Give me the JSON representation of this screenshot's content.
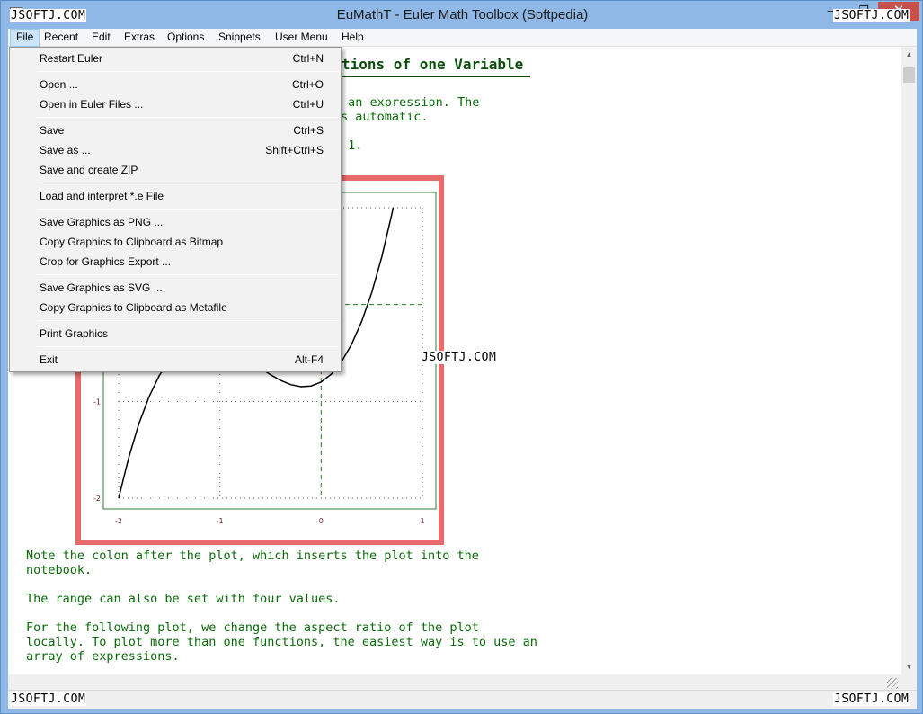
{
  "window": {
    "title": "EuMathT - Euler Math Toolbox (Softpedia)",
    "minimize_glyph": "—",
    "maximize_glyph": "❐",
    "close_glyph": "✕"
  },
  "watermarks": [
    "JSOFTJ.COM",
    "JSOFTJ.COM",
    "JSOFTJ.COM",
    "JSOFTJ.COM",
    "JSOFTJ.COM"
  ],
  "menubar": {
    "items": [
      "File",
      "Recent",
      "Edit",
      "Extras",
      "Options",
      "Snippets",
      "User Menu",
      "Help"
    ]
  },
  "file_menu": {
    "items": [
      {
        "label": "Restart Euler",
        "shortcut": "Ctrl+N"
      },
      {
        "label": "Open ...",
        "shortcut": "Ctrl+O"
      },
      {
        "label": "Open in Euler Files ...",
        "shortcut": "Ctrl+U"
      },
      {
        "label": "Save",
        "shortcut": "Ctrl+S"
      },
      {
        "label": "Save as ...",
        "shortcut": "Shift+Ctrl+S"
      },
      {
        "label": "Save and create ZIP",
        "shortcut": ""
      },
      {
        "label": "Load and interpret *.e File",
        "shortcut": ""
      },
      {
        "label": "Save Graphics as PNG ...",
        "shortcut": ""
      },
      {
        "label": "Copy Graphics to Clipboard as Bitmap",
        "shortcut": ""
      },
      {
        "label": "Crop for Graphics Export ...",
        "shortcut": ""
      },
      {
        "label": "Save Graphics as SVG ...",
        "shortcut": ""
      },
      {
        "label": "Copy Graphics to Clipboard as Metafile",
        "shortcut": ""
      },
      {
        "label": "Print Graphics",
        "shortcut": ""
      },
      {
        "label": "Exit",
        "shortcut": "Alt-F4"
      }
    ]
  },
  "notebook": {
    "heading": "tions of one Variable",
    "intro_line1": " an expression. The",
    "intro_line2": "s automatic.",
    "intro_line3": " 1.",
    "note1_line1": "Note the colon after the plot, which inserts the plot into the",
    "note1_line2": "notebook.",
    "note2": "The range can also be set with four values.",
    "note3_line1": "For the following plot, we change the aspect ratio of the plot",
    "note3_line2": "locally. To plot more than one functions, the easiest way is to use an",
    "note3_line3": "array of expressions."
  },
  "chart_data": {
    "type": "line",
    "xlim": [
      -2,
      1
    ],
    "ylim": [
      -2,
      1
    ],
    "x_tick_labels": [
      "-2",
      "-1",
      "0",
      "1"
    ],
    "y_tick_labels": [
      "-1",
      "-2"
    ],
    "grid": true,
    "series": [
      {
        "x": [
          -2.0,
          -1.9,
          -1.8,
          -1.7,
          -1.6,
          -1.5,
          -1.4,
          -1.3,
          -1.2,
          -1.1,
          -1.0,
          -0.9,
          -0.8,
          -0.7,
          -0.6,
          -0.5,
          -0.4,
          -0.3,
          -0.2,
          -0.1,
          0.0,
          0.1,
          0.2,
          0.3,
          0.4,
          0.5,
          0.6,
          0.7,
          0.8,
          0.9,
          1.0
        ],
        "y": [
          -2.0,
          -1.579,
          -1.232,
          -0.953,
          -0.736,
          -0.575,
          -0.464,
          -0.397,
          -0.368,
          -0.371,
          -0.4,
          -0.449,
          -0.512,
          -0.583,
          -0.656,
          -0.725,
          -0.784,
          -0.827,
          -0.848,
          -0.841,
          -0.8,
          -0.719,
          -0.592,
          -0.413,
          -0.176,
          0.125,
          0.496,
          0.943,
          1.472,
          2.089,
          2.8
        ]
      }
    ]
  }
}
